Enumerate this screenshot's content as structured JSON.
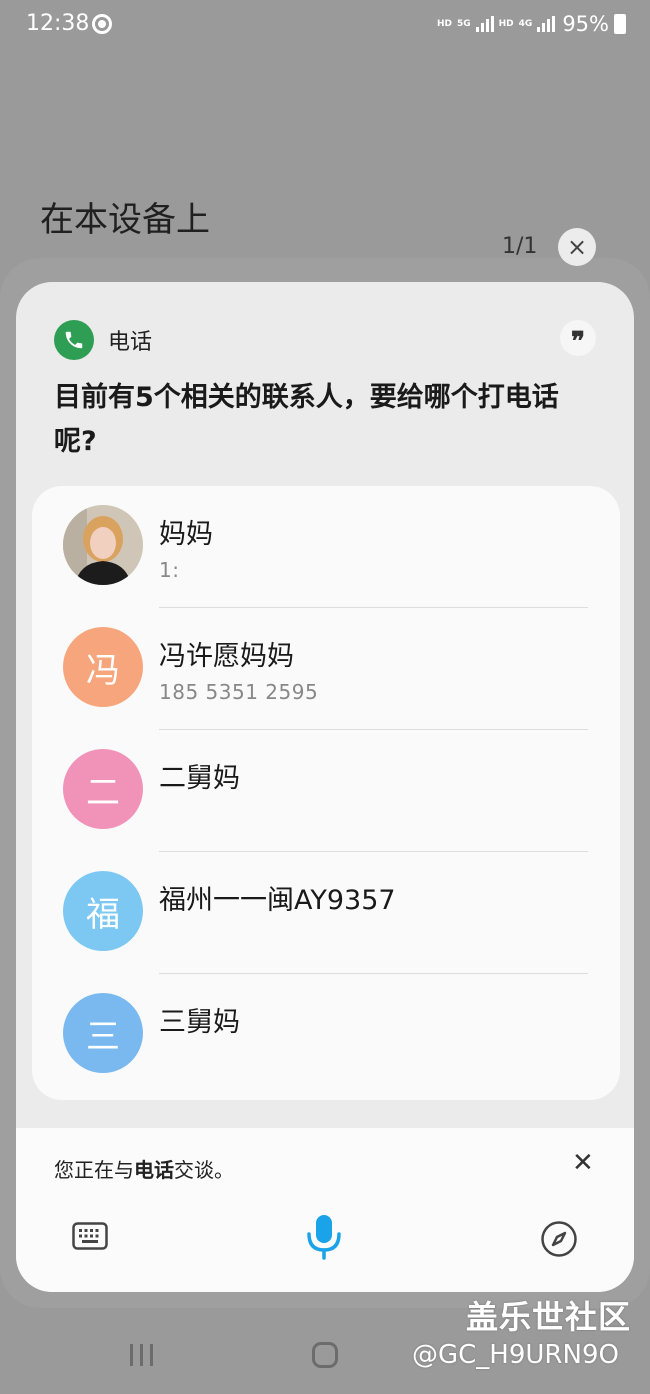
{
  "status_bar": {
    "time": "12:38",
    "net1": "HD",
    "net2": "5G",
    "net3": "HD",
    "net4": "4G",
    "battery": "95%"
  },
  "context": {
    "title": "在本设备上",
    "page_indicator": "1/1",
    "dismiss": "×"
  },
  "panel": {
    "app_name": "电话",
    "quote_glyph": "❞",
    "prompt": "目前有5个相关的联系人，要给哪个打电话呢?"
  },
  "contacts": [
    {
      "name": "妈妈",
      "sub": "1:",
      "avatar": "",
      "color": "#d8d2c8"
    },
    {
      "name": "冯许愿妈妈",
      "sub": "185 5351 2595",
      "avatar": "冯",
      "color": "#f7a57c"
    },
    {
      "name": "二舅妈",
      "sub": "",
      "avatar": "二",
      "color": "#f193b9"
    },
    {
      "name": "福州一一闽AY9357",
      "sub": "",
      "avatar": "福",
      "color": "#7cc8f2"
    },
    {
      "name": "三舅妈",
      "sub": "",
      "avatar": "三",
      "color": "#7ab9f0"
    }
  ],
  "bottom": {
    "talking_prefix": "您正在与",
    "talking_app": "电话",
    "talking_suffix": "交谈。",
    "close": "✕"
  },
  "watermark": {
    "title": "盖乐世社区",
    "handle": "@GC_H9URN9O"
  },
  "colors": {
    "phone_icon": "#2e9e55",
    "mic": "#1aa3e8"
  }
}
